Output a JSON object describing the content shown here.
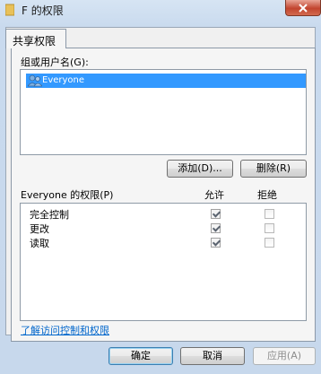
{
  "window": {
    "title": "F 的权限",
    "icon": "folder-icon"
  },
  "tabs": [
    {
      "label": "共享权限",
      "active": true
    }
  ],
  "groups": {
    "label": "组或用户名(G):",
    "items": [
      {
        "name": "Everyone",
        "selected": true,
        "icon": "users-group-icon"
      }
    ]
  },
  "buttons": {
    "add": "添加(D)...",
    "remove": "删除(R)",
    "ok": "确定",
    "cancel": "取消",
    "apply": "应用(A)"
  },
  "permissions": {
    "header": "Everyone 的权限(P)",
    "allow_label": "允许",
    "deny_label": "拒绝",
    "rows": [
      {
        "name": "完全控制",
        "allow": true,
        "deny": false
      },
      {
        "name": "更改",
        "allow": true,
        "deny": false
      },
      {
        "name": "读取",
        "allow": true,
        "deny": false
      }
    ]
  },
  "link": "了解访问控制和权限"
}
